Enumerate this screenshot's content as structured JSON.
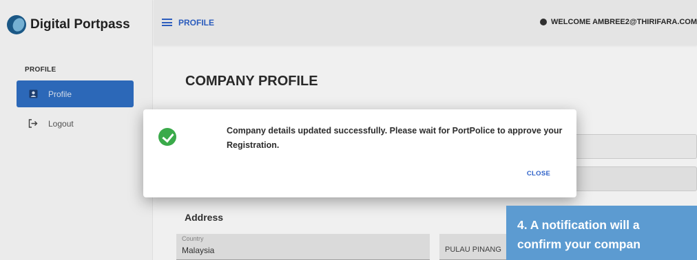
{
  "app": {
    "logo_text": "Digital Portpass"
  },
  "sidebar": {
    "heading": "PROFILE",
    "items": [
      {
        "label": "Profile",
        "icon": "person-card-icon",
        "active": true
      },
      {
        "label": "Logout",
        "icon": "logout-icon",
        "active": false
      }
    ]
  },
  "header": {
    "title": "PROFILE",
    "welcome": "WELCOME AMBREE2@THIRIFARA.COM"
  },
  "main": {
    "page_title": "COMPANY PROFILE",
    "address_section": "Address",
    "country_label": "Country",
    "country_value": "Malaysia",
    "state_value": "PULAU PINANG"
  },
  "dialog": {
    "message": "Company details updated successfully. Please wait for PortPolice to approve your Registration.",
    "close_label": "CLOSE",
    "icon": "success-check-icon"
  },
  "callout": {
    "text": "4. A notification will a\nconfirm your compan"
  },
  "colors": {
    "accent": "#2e62c9",
    "active_nav": "#2f6fc4",
    "success": "#3aaa4a",
    "callout_bg": "#5c9bd1"
  }
}
